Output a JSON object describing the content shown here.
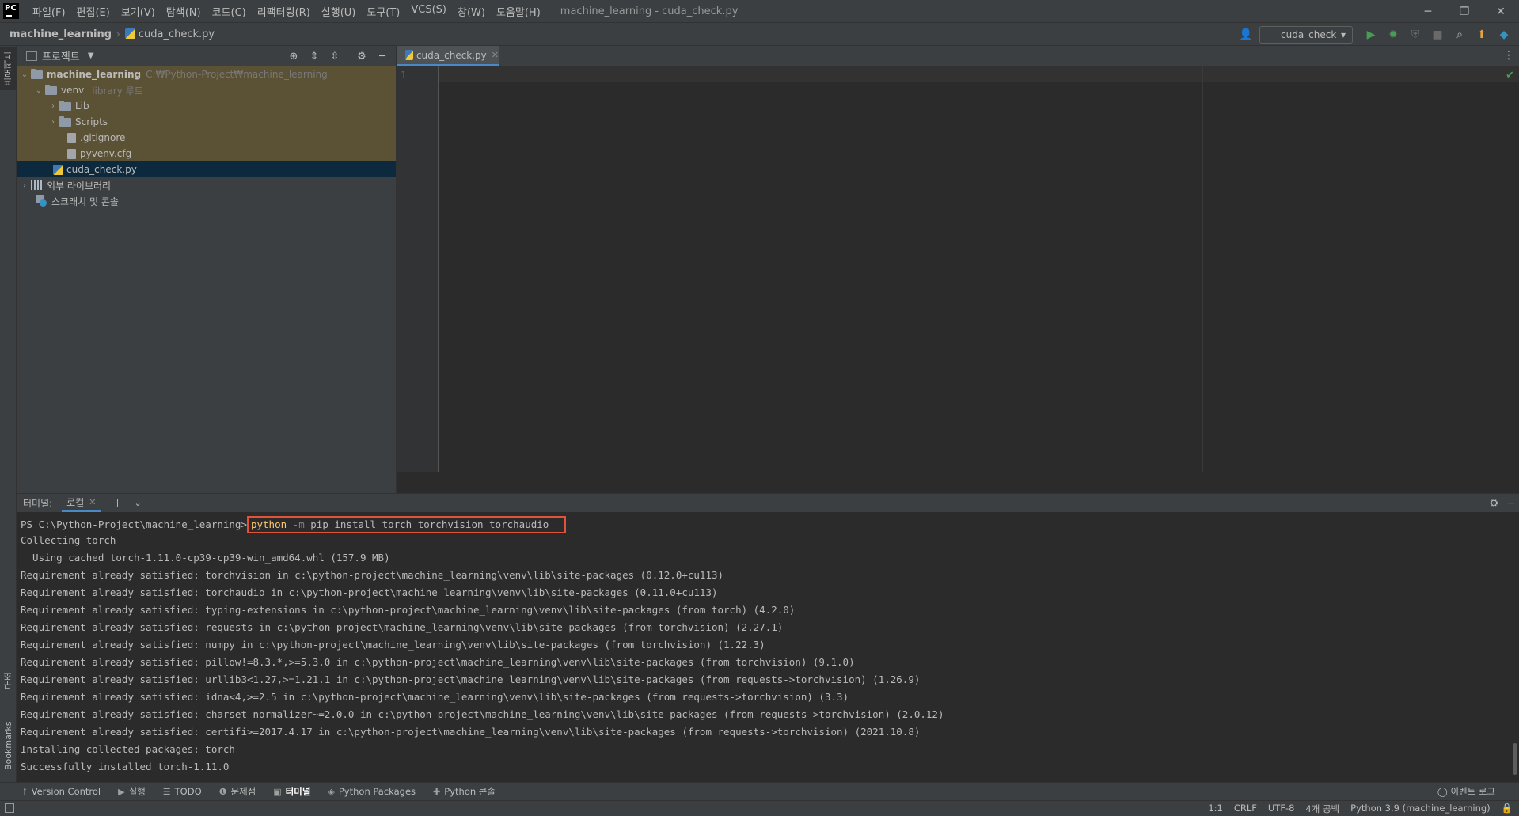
{
  "titlebar": {
    "logo": "PC",
    "menu": [
      "파일(F)",
      "편집(E)",
      "보기(V)",
      "탐색(N)",
      "코드(C)",
      "리팩터링(R)",
      "실행(U)",
      "도구(T)",
      "VCS(S)",
      "창(W)",
      "도움말(H)"
    ],
    "window_title": "machine_learning - cuda_check.py",
    "minimize": "─",
    "restore": "❐",
    "close": "✕"
  },
  "navbar": {
    "project": "machine_learning",
    "file": "cuda_check.py",
    "run_config": "cuda_check"
  },
  "left_strip": {
    "project_tab": "프로젝트",
    "structure_tab": "구조",
    "bookmarks_tab": "Bookmarks"
  },
  "project_panel": {
    "title": "프로젝트",
    "tree": [
      {
        "label": "machine_learning",
        "sub": "C:₩Python-Project₩machine_learning",
        "arrow": "⌄",
        "type": "folder",
        "bold": true
      },
      {
        "label": "venv",
        "sub": "library 루트",
        "arrow": "⌄",
        "type": "folder"
      },
      {
        "label": "Lib",
        "sub": "",
        "arrow": "›",
        "type": "folder"
      },
      {
        "label": "Scripts",
        "sub": "",
        "arrow": "›",
        "type": "folder"
      },
      {
        "label": ".gitignore",
        "sub": "",
        "arrow": "",
        "type": "file"
      },
      {
        "label": "pyvenv.cfg",
        "sub": "",
        "arrow": "",
        "type": "file"
      },
      {
        "label": "cuda_check.py",
        "sub": "",
        "arrow": "",
        "type": "py"
      },
      {
        "label": "외부 라이브러리",
        "sub": "",
        "arrow": "›",
        "type": "lib"
      },
      {
        "label": "스크래치 및 콘솔",
        "sub": "",
        "arrow": "",
        "type": "scratch"
      }
    ]
  },
  "editor": {
    "tab": "cuda_check.py",
    "line_number": "1"
  },
  "terminal": {
    "title": "터미널:",
    "tab": "로컬",
    "prompt": "PS C:\\Python-Project\\machine_learning>",
    "cmd_python": "python",
    "cmd_flag": "-m",
    "cmd_rest": "pip install torch torchvision torchaudio",
    "lines": [
      "Collecting torch",
      "  Using cached torch-1.11.0-cp39-cp39-win_amd64.whl (157.9 MB)",
      "Requirement already satisfied: torchvision in c:\\python-project\\machine_learning\\venv\\lib\\site-packages (0.12.0+cu113)",
      "Requirement already satisfied: torchaudio in c:\\python-project\\machine_learning\\venv\\lib\\site-packages (0.11.0+cu113)",
      "Requirement already satisfied: typing-extensions in c:\\python-project\\machine_learning\\venv\\lib\\site-packages (from torch) (4.2.0)",
      "Requirement already satisfied: requests in c:\\python-project\\machine_learning\\venv\\lib\\site-packages (from torchvision) (2.27.1)",
      "Requirement already satisfied: numpy in c:\\python-project\\machine_learning\\venv\\lib\\site-packages (from torchvision) (1.22.3)",
      "Requirement already satisfied: pillow!=8.3.*,>=5.3.0 in c:\\python-project\\machine_learning\\venv\\lib\\site-packages (from torchvision) (9.1.0)",
      "Requirement already satisfied: urllib3<1.27,>=1.21.1 in c:\\python-project\\machine_learning\\venv\\lib\\site-packages (from requests->torchvision) (1.26.9)",
      "Requirement already satisfied: idna<4,>=2.5 in c:\\python-project\\machine_learning\\venv\\lib\\site-packages (from requests->torchvision) (3.3)",
      "Requirement already satisfied: charset-normalizer~=2.0.0 in c:\\python-project\\machine_learning\\venv\\lib\\site-packages (from requests->torchvision) (2.0.12)",
      "Requirement already satisfied: certifi>=2017.4.17 in c:\\python-project\\machine_learning\\venv\\lib\\site-packages (from requests->torchvision) (2021.10.8)",
      "Installing collected packages: torch",
      "Successfully installed torch-1.11.0"
    ]
  },
  "tool_windows": [
    {
      "label": "Version Control",
      "icon": "ᚠ"
    },
    {
      "label": "실행",
      "icon": "▶"
    },
    {
      "label": "TODO",
      "icon": "☰"
    },
    {
      "label": "문제점",
      "icon": "❶"
    },
    {
      "label": "터미널",
      "icon": "▣"
    },
    {
      "label": "Python Packages",
      "icon": "◈"
    },
    {
      "label": "Python 콘솔",
      "icon": "✚"
    }
  ],
  "event_log": "이벤트 로그",
  "status": {
    "position": "1:1",
    "line_sep": "CRLF",
    "encoding": "UTF-8",
    "indent": "4개 공백",
    "interpreter": "Python 3.9 (machine_learning)"
  }
}
